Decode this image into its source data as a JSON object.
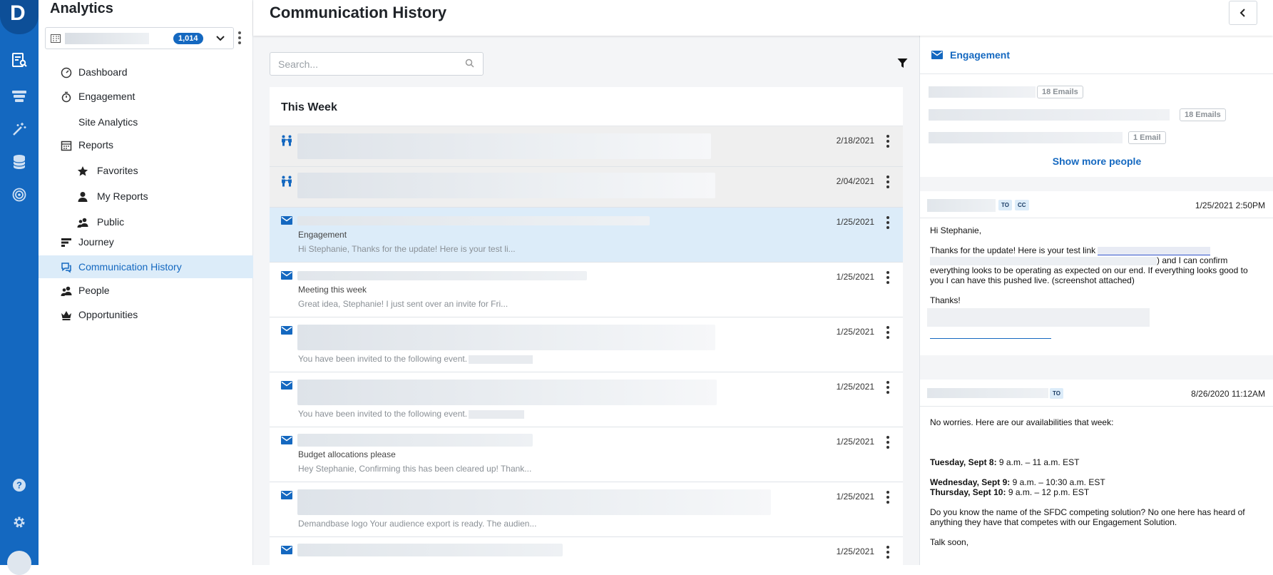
{
  "brand": {
    "logo_letter": "D",
    "app_title": "Analytics"
  },
  "account": {
    "count": "1,014"
  },
  "nav": {
    "items": [
      {
        "label": "Dashboard"
      },
      {
        "label": "Engagement"
      },
      {
        "label": "Site Analytics"
      },
      {
        "label": "Reports"
      },
      {
        "label": "Favorites"
      },
      {
        "label": "My Reports"
      },
      {
        "label": "Public"
      },
      {
        "label": "Journey"
      },
      {
        "label": "Communication History"
      },
      {
        "label": "People"
      },
      {
        "label": "Opportunities"
      }
    ],
    "active": "Communication History"
  },
  "header": {
    "title": "Communication History"
  },
  "search": {
    "placeholder": "Search..."
  },
  "list": {
    "section_title": "This Week",
    "rows": [
      {
        "type": "meeting",
        "date": "2/18/2021",
        "subject": "",
        "preview": ""
      },
      {
        "type": "meeting",
        "date": "2/04/2021",
        "subject": "",
        "preview": ""
      },
      {
        "type": "email",
        "date": "1/25/2021",
        "subject": "Engagement",
        "preview": "Hi Stephanie, Thanks for the update! Here is your test li..."
      },
      {
        "type": "email",
        "date": "1/25/2021",
        "subject": "Meeting this week",
        "preview": "Great idea, Stephanie! I just sent over an invite for Fri..."
      },
      {
        "type": "email",
        "date": "1/25/2021",
        "subject": "",
        "preview": "You have been invited to the following event."
      },
      {
        "type": "email",
        "date": "1/25/2021",
        "subject": "",
        "preview": "You have been invited to the following event."
      },
      {
        "type": "email",
        "date": "1/25/2021",
        "subject": "Budget allocations please",
        "preview": "Hey Stephanie, Confirming this has been cleared up! Thank..."
      },
      {
        "type": "email",
        "date": "1/25/2021",
        "subject": "",
        "preview": "Demandbase logo Your audience export is ready. The audien..."
      },
      {
        "type": "email",
        "date": "1/25/2021",
        "subject": "",
        "preview": ""
      }
    ]
  },
  "engagement_panel": {
    "title": "Engagement",
    "people": [
      {
        "emails": "18 Emails"
      },
      {
        "emails": "18 Emails"
      },
      {
        "emails": "1 Email"
      }
    ],
    "show_more": "Show more people"
  },
  "email_detail_1": {
    "badges": [
      "TO",
      "CC"
    ],
    "timestamp": "1/25/2021 2:50PM",
    "greeting": "Hi Stephanie,",
    "line1": "Thanks for the update! Here is your test link",
    "line2": ") and I can confirm",
    "line3": "everything looks to be operating as expected on our end. If everything looks good to you I can have this pushed live. (screenshot attached)",
    "signoff": "Thanks!"
  },
  "email_detail_2": {
    "badges": [
      "TO"
    ],
    "timestamp": "8/26/2020 11:12AM",
    "intro": "No worries.  Here are our availabilities that week:",
    "slots": [
      {
        "day": "Tuesday, Sept 8:",
        "time": " 9 a.m. – 11 a.m. EST"
      },
      {
        "day": "Wednesday, Sept 9:",
        "time": " 9 a.m. – 10:30 a.m. EST"
      },
      {
        "day": "Thursday, Sept 10:",
        "time": " 9 a.m. – 12 p.m. EST"
      }
    ],
    "question": "Do you know the name of the SFDC competing solution? No one here has heard of anything they have that competes with our Engagement Solution.",
    "closing": "Talk soon,"
  },
  "colors": {
    "brand": "#1468c0",
    "active_bg": "#dcecf9",
    "rail_dark": "#0d4f98"
  }
}
